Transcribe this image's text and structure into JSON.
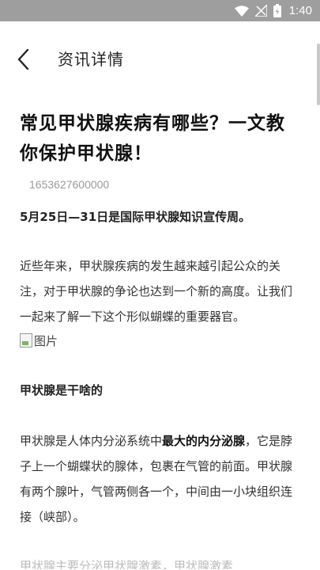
{
  "status_bar": {
    "time": "1:40",
    "icons": [
      "wifi-icon",
      "signal-icon",
      "battery-icon"
    ],
    "background": "#9e9e9e"
  },
  "header": {
    "back_icon": "chevron-left-icon",
    "title": "资讯详情"
  },
  "article": {
    "title": "常见甲状腺疾病有哪些？一文教你保护甲状腺！",
    "timestamp": "1653627600000",
    "paragraphs": {
      "lead": "5月25日—31日是国际甲状腺知识宣传周。",
      "intro": "近些年来，甲状腺疾病的发生越来越引起公众的关注，对于甲状腺的争论也达到一个新的高度。让我们一起来了解一下这个形似蝴蝶的重要器官。",
      "image_alt": "图片",
      "section_heading": "甲状腺是干啥的",
      "body_pre": "甲状腺是人体内分泌系统中",
      "body_em": "最大的内分泌腺",
      "body_post": "，它是脖子上一个蝴蝶状的腺体，包裹在气管的前面。甲状腺有两个腺叶，气管两侧各一个，中间由一小块组织连接（峡部）。",
      "cutoff": "甲状腺主要分泌甲状腺激素，甲状腺激素"
    }
  }
}
